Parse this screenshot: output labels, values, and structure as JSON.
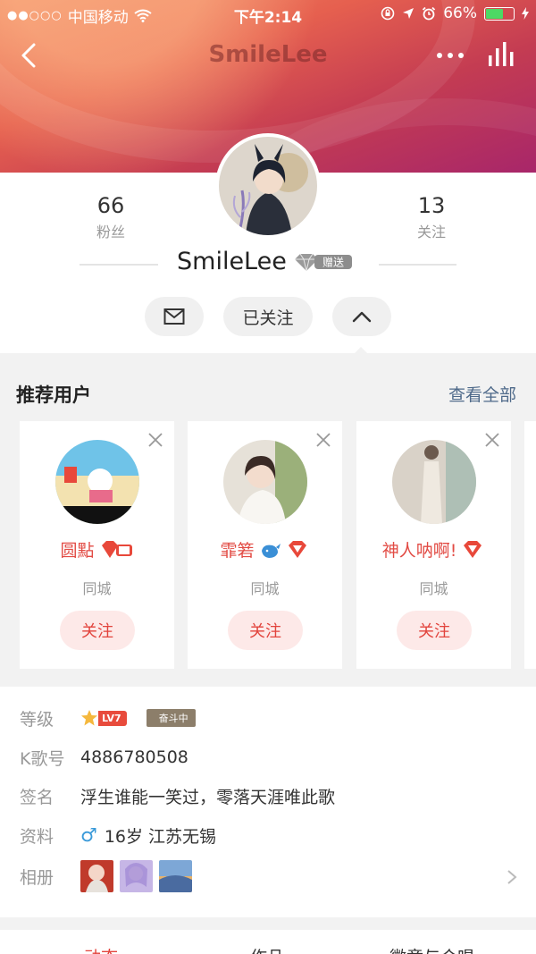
{
  "status_bar": {
    "carrier": "中国移动",
    "time": "下午2:14",
    "battery": "66%",
    "battery_level": 0.66
  },
  "nav": {
    "title": "SmileLee"
  },
  "profile": {
    "fans_count": "66",
    "fans_label": "粉丝",
    "follow_count": "13",
    "follow_label": "关注",
    "username": "SmileLee",
    "gift_badge": "赠送",
    "followed_label": "已关注"
  },
  "recommend": {
    "title": "推荐用户",
    "view_all": "查看全部",
    "follow_label": "关注",
    "users": [
      {
        "name": "圆點",
        "city": "同城"
      },
      {
        "name": "霏箬",
        "city": "同城"
      },
      {
        "name": "神人呐啊!",
        "city": "同城"
      }
    ]
  },
  "info": {
    "level_label": "等级",
    "level_badge": "LV7",
    "rank_badge": "奋斗中",
    "kid_label": "K歌号",
    "kid_value": "4886780508",
    "sign_label": "签名",
    "sign_value": "浮生谁能一笑过，零落天涯唯此歌",
    "profile_label": "资料",
    "gender_symbol": "♂",
    "profile_value": "16岁 江苏无锡",
    "album_label": "相册"
  },
  "tabs": [
    "动态",
    "作品",
    "徽章与合唱"
  ],
  "colors": {
    "accent": "#e24b44",
    "link": "#4f6a8a",
    "gender": "#3a9ad9"
  }
}
